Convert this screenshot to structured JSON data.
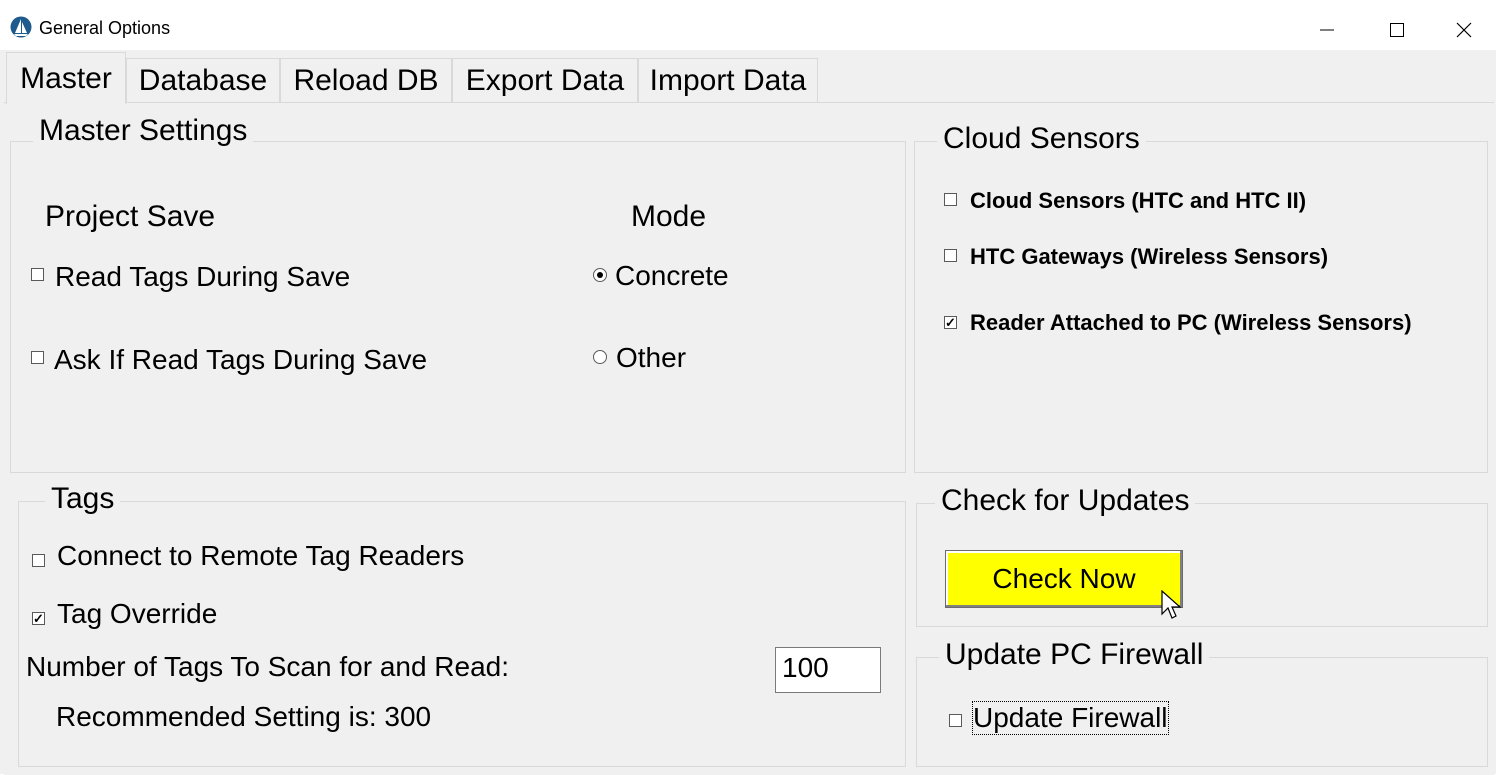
{
  "window": {
    "title": "General Options",
    "app_icon": "app-logo-icon"
  },
  "titlebar_buttons": {
    "minimize": "minimize-icon",
    "maximize": "maximize-icon",
    "close": "close-icon"
  },
  "tabs": [
    {
      "label": "Master",
      "active": true
    },
    {
      "label": "Database",
      "active": false
    },
    {
      "label": "Reload DB",
      "active": false
    },
    {
      "label": "Export Data",
      "active": false
    },
    {
      "label": "Import Data",
      "active": false
    }
  ],
  "master_settings": {
    "legend": "Master Settings",
    "project_save_heading": "Project Save",
    "mode_heading": "Mode",
    "read_tags": {
      "label": "Read Tags During Save",
      "checked": false
    },
    "ask_read_tags": {
      "label": "Ask If Read Tags During Save",
      "checked": false
    },
    "mode_concrete": {
      "label": "Concrete",
      "selected": true
    },
    "mode_other": {
      "label": "Other",
      "selected": false
    }
  },
  "cloud_sensors": {
    "legend": "Cloud Sensors",
    "items": [
      {
        "label": "Cloud Sensors (HTC and HTC II)",
        "checked": false
      },
      {
        "label": "HTC Gateways (Wireless Sensors)",
        "checked": false
      },
      {
        "label": "Reader Attached to PC (Wireless Sensors)",
        "checked": true
      }
    ]
  },
  "tags": {
    "legend": "Tags",
    "connect_remote": {
      "label": "Connect to Remote Tag Readers",
      "checked": false
    },
    "tag_override": {
      "label": "Tag Override",
      "checked": true
    },
    "num_tags_label": "Number of Tags To Scan for and Read:",
    "num_tags_value": "100",
    "recommended": "Recommended Setting is: 300"
  },
  "updates": {
    "legend": "Check for Updates",
    "button_label": "Check Now",
    "button_color": "#ffff00"
  },
  "firewall": {
    "legend": "Update PC Firewall",
    "update_firewall": {
      "label": "Update Firewall",
      "checked": false
    }
  }
}
